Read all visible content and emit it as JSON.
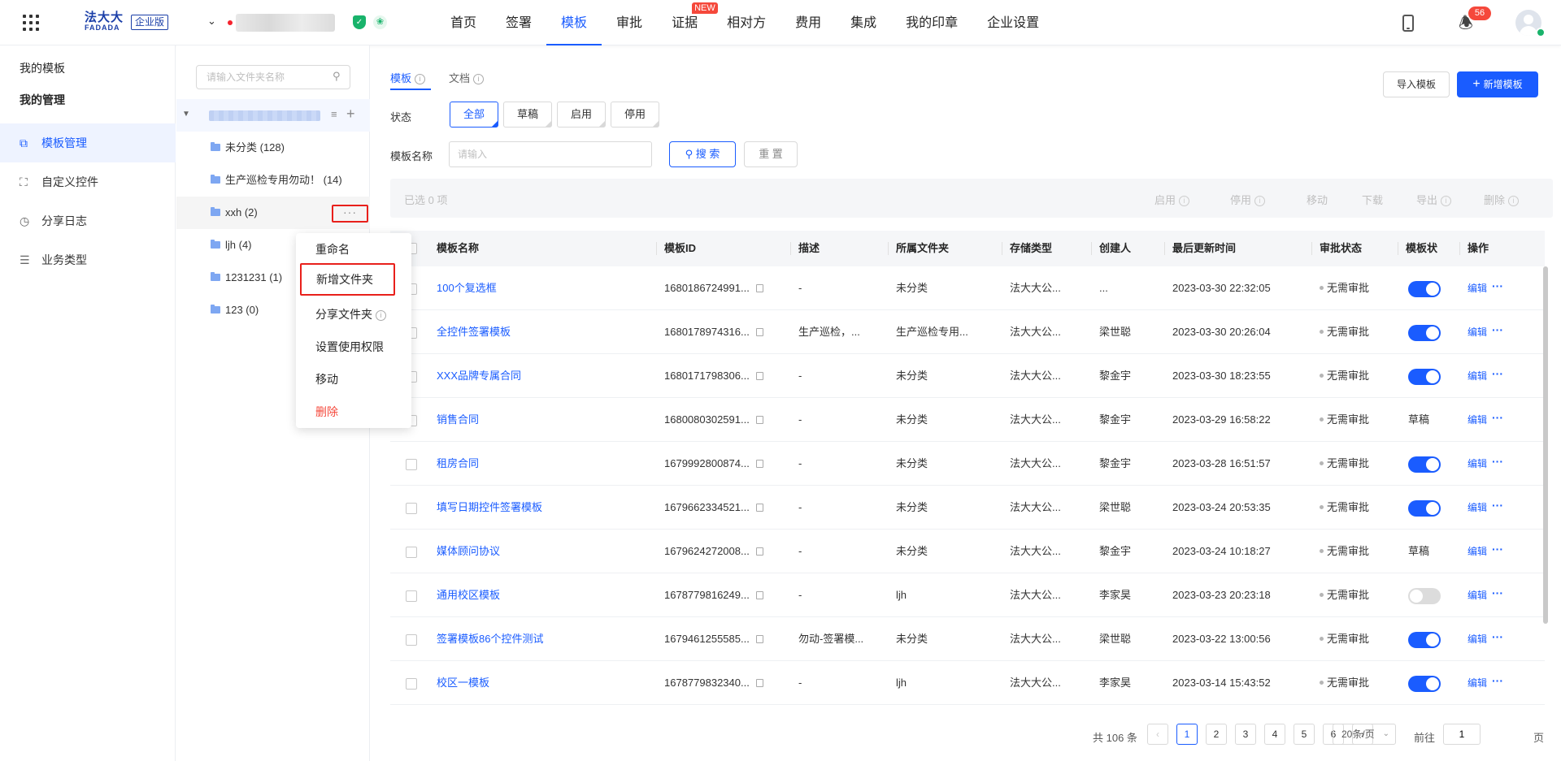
{
  "header": {
    "logo_cn": "法大大",
    "logo_en": "FADADA",
    "edition": "企业版",
    "nav": [
      {
        "label": "首页",
        "active": false
      },
      {
        "label": "签署",
        "active": false
      },
      {
        "label": "模板",
        "active": true
      },
      {
        "label": "审批",
        "active": false
      },
      {
        "label": "证据",
        "active": false,
        "tag": "NEW"
      },
      {
        "label": "相对方",
        "active": false
      },
      {
        "label": "费用",
        "active": false
      },
      {
        "label": "集成",
        "active": false
      },
      {
        "label": "我的印章",
        "active": false
      },
      {
        "label": "企业设置",
        "active": false
      }
    ],
    "notification_count": "56"
  },
  "side_menu": {
    "section1": "我的模板",
    "section2": "我的管理",
    "items": [
      {
        "label": "模板管理",
        "icon": "template-icon",
        "active": true
      },
      {
        "label": "自定义控件",
        "icon": "scan-icon",
        "active": false
      },
      {
        "label": "分享日志",
        "icon": "clock-icon",
        "active": false
      },
      {
        "label": "业务类型",
        "icon": "list-icon",
        "active": false
      }
    ]
  },
  "folder_panel": {
    "search_placeholder": "请输入文件夹名称",
    "folders": [
      {
        "label": "未分类 (128)"
      },
      {
        "label": "生产巡检专用勿动！ (14)"
      },
      {
        "label": "xxh (2)"
      },
      {
        "label": "ljh (4)"
      },
      {
        "label": "1231231 (1)"
      },
      {
        "label": "123 (0)"
      }
    ],
    "more_label": "···"
  },
  "context_menu": {
    "items": [
      {
        "label": "重命名"
      },
      {
        "label": "新增文件夹"
      },
      {
        "label": "分享文件夹"
      },
      {
        "label": "设置使用权限"
      },
      {
        "label": "移动"
      },
      {
        "label": "删除"
      }
    ]
  },
  "main": {
    "tabs": [
      {
        "label": "模板"
      },
      {
        "label": "文档"
      }
    ],
    "import_label": "导入模板",
    "new_label": "新增模板",
    "status_label": "状态",
    "status_options": [
      "全部",
      "草稿",
      "启用",
      "停用"
    ],
    "name_label": "模板名称",
    "name_placeholder": "请输入",
    "search_label": "搜 索",
    "reset_label": "重 置",
    "selected_text": "已选  0  项",
    "actions": [
      "启用",
      "停用",
      "移动",
      "下载",
      "导出",
      "删除"
    ]
  },
  "table": {
    "columns": [
      "模板名称",
      "模板ID",
      "描述",
      "所属文件夹",
      "存储类型",
      "创建人",
      "最后更新时间",
      "审批状态",
      "模板状",
      "操作"
    ],
    "rows": [
      {
        "name": "100个复选框",
        "id": "1680186724991...",
        "desc": "-",
        "folder": "未分类",
        "storage": "法大大公...",
        "creator": "...",
        "updated": "2023-03-30 22:32:05",
        "approval": "无需审批",
        "status": "on",
        "op": "编辑"
      },
      {
        "name": "全控件签署模板",
        "id": "1680178974316...",
        "desc": "生产巡检，...",
        "folder": "生产巡检专用...",
        "storage": "法大大公...",
        "creator": "梁世聪",
        "updated": "2023-03-30 20:26:04",
        "approval": "无需审批",
        "status": "on",
        "op": "编辑"
      },
      {
        "name": "XXX品牌专属合同",
        "id": "1680171798306...",
        "desc": "-",
        "folder": "未分类",
        "storage": "法大大公...",
        "creator": "黎金宇",
        "updated": "2023-03-30 18:23:55",
        "approval": "无需审批",
        "status": "on",
        "op": "编辑"
      },
      {
        "name": "销售合同",
        "id": "1680080302591...",
        "desc": "-",
        "folder": "未分类",
        "storage": "法大大公...",
        "creator": "黎金宇",
        "updated": "2023-03-29 16:58:22",
        "approval": "无需审批",
        "status": "草稿",
        "op": "编辑"
      },
      {
        "name": "租房合同",
        "id": "1679992800874...",
        "desc": "-",
        "folder": "未分类",
        "storage": "法大大公...",
        "creator": "黎金宇",
        "updated": "2023-03-28 16:51:57",
        "approval": "无需审批",
        "status": "on",
        "op": "编辑"
      },
      {
        "name": "填写日期控件签署模板",
        "id": "1679662334521...",
        "desc": "-",
        "folder": "未分类",
        "storage": "法大大公...",
        "creator": "梁世聪",
        "updated": "2023-03-24 20:53:35",
        "approval": "无需审批",
        "status": "on",
        "op": "编辑"
      },
      {
        "name": "媒体顾问协议",
        "id": "1679624272008...",
        "desc": "-",
        "folder": "未分类",
        "storage": "法大大公...",
        "creator": "黎金宇",
        "updated": "2023-03-24 10:18:27",
        "approval": "无需审批",
        "status": "草稿",
        "op": "编辑"
      },
      {
        "name": "通用校区模板",
        "id": "1678779816249...",
        "desc": "-",
        "folder": "ljh",
        "storage": "法大大公...",
        "creator": "李家昊",
        "updated": "2023-03-23 20:23:18",
        "approval": "无需审批",
        "status": "off",
        "op": "编辑"
      },
      {
        "name": "签署模板86个控件测试",
        "id": "1679461255585...",
        "desc": "勿动-签署模...",
        "folder": "未分类",
        "storage": "法大大公...",
        "creator": "梁世聪",
        "updated": "2023-03-22 13:00:56",
        "approval": "无需审批",
        "status": "on",
        "op": "编辑"
      },
      {
        "name": "校区一模板",
        "id": "1678779832340...",
        "desc": "-",
        "folder": "ljh",
        "storage": "法大大公...",
        "creator": "李家昊",
        "updated": "2023-03-14 15:43:52",
        "approval": "无需审批",
        "status": "on",
        "op": "编辑"
      }
    ]
  },
  "pagination": {
    "total": "共 106 条",
    "pages": [
      "1",
      "2",
      "3",
      "4",
      "5",
      "6"
    ],
    "current": "1",
    "page_size": "20条/页",
    "goto_label": "前往",
    "goto_value": "1",
    "page_suffix": "页"
  },
  "colors": {
    "primary": "#1a5cff",
    "danger": "#f5483b",
    "success": "#19b36b"
  }
}
